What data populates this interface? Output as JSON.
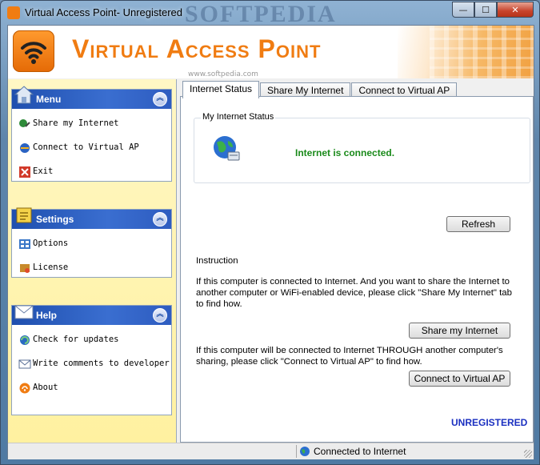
{
  "window": {
    "title": "Virtual Access Point- Unregistered",
    "watermark": "SOFTPEDIA",
    "controls": {
      "minimize": "—",
      "maximize": "☐",
      "close": "✕"
    }
  },
  "banner": {
    "app_title": "Virtual Access Point",
    "softpedia_url": "www.softpedia.com",
    "accent_color": "#f07c12"
  },
  "sidebar": {
    "panels": [
      {
        "title": "Menu",
        "icon": "home-icon",
        "items": [
          {
            "label": "Share my Internet",
            "icon": "share-icon"
          },
          {
            "label": "Connect to Virtual AP",
            "icon": "connect-icon"
          },
          {
            "label": "Exit",
            "icon": "exit-icon"
          }
        ]
      },
      {
        "title": "Settings",
        "icon": "settings-icon",
        "items": [
          {
            "label": "Options",
            "icon": "options-icon"
          },
          {
            "label": "License",
            "icon": "license-icon"
          }
        ]
      },
      {
        "title": "Help",
        "icon": "mail-icon",
        "items": [
          {
            "label": "Check for updates",
            "icon": "update-icon"
          },
          {
            "label": "Write comments to developer",
            "icon": "write-icon"
          },
          {
            "label": "About",
            "icon": "about-icon"
          }
        ]
      }
    ]
  },
  "tabs": [
    {
      "label": "Internet Status",
      "active": true
    },
    {
      "label": "Share My Internet",
      "active": false
    },
    {
      "label": "Connect to Virtual AP",
      "active": false
    }
  ],
  "status_tab": {
    "group_label": "My Internet Status",
    "connection_status": "Internet is connected.",
    "refresh_label": "Refresh",
    "instruction_heading": "Instruction",
    "instruction_1": "If this computer is connected to Internet. And you want to share the Internet to another computer or WiFi-enabled device, please click \"Share My Internet\" tab to find how.",
    "share_button": "Share my Internet",
    "instruction_2": "If this computer will be connected to Internet THROUGH another computer's sharing, please click \"Connect to Virtual AP\" to find how.",
    "connect_button": "Connect to Virtual AP",
    "registration_status": "UNREGISTERED"
  },
  "statusbar": {
    "text": "Connected to Internet"
  }
}
